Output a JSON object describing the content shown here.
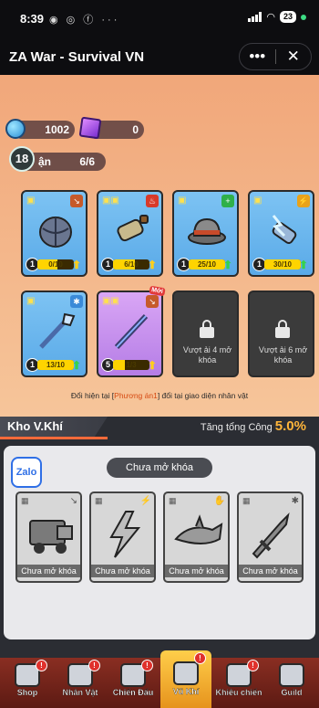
{
  "status_bar": {
    "time": "8:39",
    "left_icons": [
      "messenger-icon",
      "zalo-icon",
      "facebook-icon",
      "more-icon"
    ],
    "battery": "23"
  },
  "app_header": {
    "title": "ZA War - Survival VN",
    "more_label": "•••",
    "close_label": "✕"
  },
  "resources": {
    "gold": "1002",
    "gems": "0"
  },
  "level": "18",
  "slots": {
    "label": "ận",
    "value": "6/6"
  },
  "equipment": [
    {
      "name": "helmet-ball",
      "level": "1",
      "progress_text": "0/10",
      "progress": 0.55,
      "rarity": "blue",
      "upgrade": "green"
    },
    {
      "name": "bottle",
      "level": "1",
      "progress_text": "6/10",
      "progress": 0.6,
      "rarity": "blue",
      "upgrade": "yellow"
    },
    {
      "name": "hat",
      "level": "1",
      "progress_text": "25/10",
      "progress": 1.0,
      "rarity": "blue",
      "upgrade": "green"
    },
    {
      "name": "lightning-glove",
      "level": "1",
      "progress_text": "30/10",
      "progress": 1.0,
      "rarity": "blue",
      "upgrade": "green"
    },
    {
      "name": "spear",
      "level": "1",
      "progress_text": "13/10",
      "progress": 1.0,
      "rarity": "blue",
      "upgrade": "green"
    },
    {
      "name": "staff",
      "level": "5",
      "progress_text": "1/3",
      "progress": 0.33,
      "rarity": "purple",
      "upgrade": "yellow",
      "badge": "Mới"
    }
  ],
  "locked_slots": [
    {
      "label": "Vượt ải 4 mở khóa"
    },
    {
      "label": "Vượt ải 6 mở khóa"
    }
  ],
  "hint": {
    "before": "Đổi hiện tại [",
    "highlight": "Phương án1",
    "after": "] đổi tại giao diện nhân vật"
  },
  "armory": {
    "title": "Kho V.Khí",
    "boost_label": "Tăng tổng Công",
    "boost_value": "5.0%",
    "zalo": "Zalo",
    "locked_label": "Chưa mở khóa",
    "items": [
      {
        "name": "truck",
        "label": "Chưa mở khóa"
      },
      {
        "name": "lightning",
        "label": "Chưa mở khóa"
      },
      {
        "name": "shark",
        "label": "Chưa mở khóa"
      },
      {
        "name": "sword",
        "label": "Chưa mở khóa"
      }
    ]
  },
  "nav": [
    {
      "label": "Shop",
      "badge": "!"
    },
    {
      "label": "Nhân Vật",
      "badge": "!"
    },
    {
      "label": "Chiến Đấu",
      "badge": "!"
    },
    {
      "label": "Vũ Khí",
      "badge": "!",
      "active": true
    },
    {
      "label": "Khiêu chiến",
      "badge": "!"
    },
    {
      "label": "Guild",
      "badge": ""
    }
  ],
  "colors": {
    "game_bg": "#f6c59a",
    "card_blue": "#6fb7ef",
    "card_purple": "#c791ee",
    "accent_orange": "#ffb53a",
    "nav_bg": "#7a2a1f"
  }
}
